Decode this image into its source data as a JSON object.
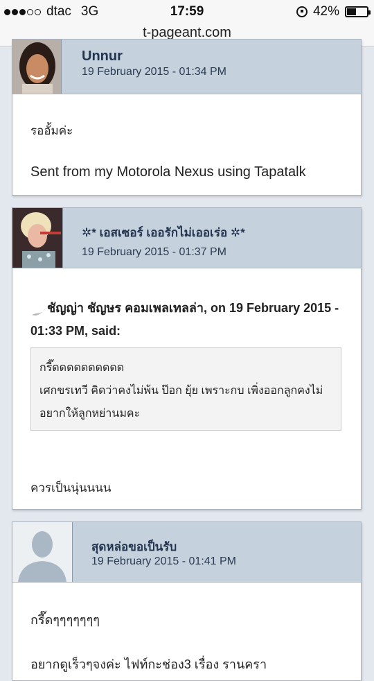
{
  "status": {
    "carrier": "dtac",
    "network": "3G",
    "time": "17:59",
    "battery": "42%"
  },
  "url": "t-pageant.com",
  "posts": [
    {
      "username": "Unnur",
      "date": "19 February 2015 - 01:34 PM",
      "lines": [
        "รออั้มค่ะ",
        "Sent from my Motorola Nexus using Tapatalk"
      ]
    },
    {
      "username": "✲* เอสเซอร์ เออรักไม่เออเร่อ ✲*",
      "date": "19 February 2015 - 01:37 PM",
      "quote_author": "ชัญญ่า ชัญษร คอมเพลเทลล่า, on 19 February 2015 - 01:33 PM, said:",
      "quote_lines": [
        "กรี๊ดดดดดดดดดด",
        "เศกขรเทวี คิดว่าคงไม่พ้น ป๊อก ยุ้ย เพราะกบ เพิ่งออกลูกคงไม่",
        "อยากให้ลูกหย่านมคะ"
      ],
      "reply": "ควรเป็นนุ่นนนน"
    },
    {
      "username": "สุดหล่อขอเป็นรับ",
      "date": "19 February 2015 - 01:41 PM",
      "lines": [
        "กรี๊ดๆๆๆๆๆๆๆ",
        "อยากดูเร็วๆจงค่ะ ไฟท์กะช่อง3 เรื่อง รานครา"
      ]
    }
  ]
}
